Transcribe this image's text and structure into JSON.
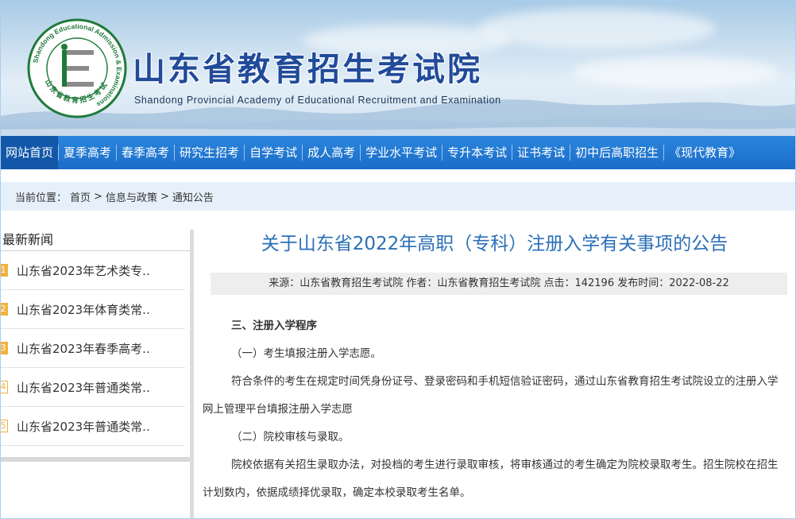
{
  "header": {
    "title": "山东省教育招生考试院",
    "subtitle": "Shandong Provincial Academy of Educational Recruitment and Examination",
    "logo": {
      "ring_text": "Shandong Educational Admission & Examinations",
      "center_text": "山东省教育招生考试"
    }
  },
  "nav": {
    "items": [
      {
        "label": "网站首页",
        "active": true
      },
      {
        "label": "夏季高考"
      },
      {
        "label": "春季高考"
      },
      {
        "label": "研究生招考"
      },
      {
        "label": "自学考试"
      },
      {
        "label": "成人高考"
      },
      {
        "label": "学业水平考试"
      },
      {
        "label": "专升本考试"
      },
      {
        "label": "证书考试"
      },
      {
        "label": "初中后高职招生"
      },
      {
        "label": "《现代教育》"
      }
    ]
  },
  "breadcrumb": {
    "prefix": "当前位置：",
    "items": [
      "首页",
      "信息与政策",
      "通知公告"
    ],
    "sep": ">"
  },
  "sidebar": {
    "title": "最新新闻",
    "items": [
      {
        "num": "1",
        "text": "山东省2023年艺术类专.."
      },
      {
        "num": "2",
        "text": "山东省2023年体育类常.."
      },
      {
        "num": "3",
        "text": "山东省2023年春季高考.."
      },
      {
        "num": "4",
        "text": "山东省2023年普通类常.."
      },
      {
        "num": "5",
        "text": "山东省2023年普通类常.."
      }
    ]
  },
  "article": {
    "title": "关于山东省2022年高职（专科）注册入学有关事项的公告",
    "meta": "来源：山东省教育招生考试院 作者：山东省教育招生考试院 点击：142196 发布时间：2022-08-22",
    "paragraphs": [
      {
        "text": "三、注册入学程序",
        "bold": true
      },
      {
        "text": "（一）考生填报注册入学志愿。"
      },
      {
        "text": "符合条件的考生在规定时间凭身份证号、登录密码和手机短信验证密码，通过山东省教育招生考试院设立的注册入学网上管理平台填报注册入学志愿"
      },
      {
        "text": "（二）院校审核与录取。"
      },
      {
        "text": "院校依据有关招生录取办法，对投档的考生进行录取审核，将审核通过的考生确定为院校录取考生。招生院校在招生计划数内，依据成绩择优录取，确定本校录取考生名单。"
      }
    ]
  },
  "colors": {
    "nav_bg": "#1a6cc8",
    "nav_active": "#1257a8",
    "title_blue": "#2a6fb8",
    "logo_green": "#1f7a3a",
    "number_badge": "#f3b13c"
  }
}
